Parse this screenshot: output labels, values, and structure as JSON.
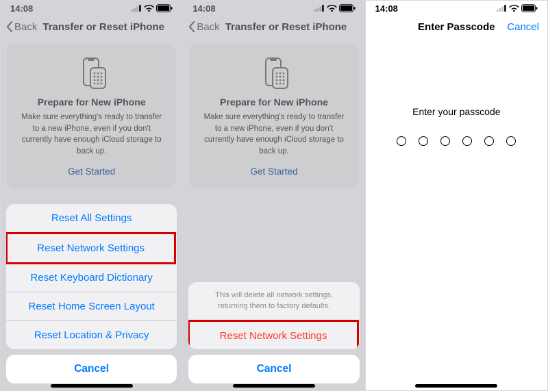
{
  "status": {
    "time": "14:08"
  },
  "nav": {
    "back_label": "Back",
    "title": "Transfer or Reset iPhone"
  },
  "card": {
    "heading": "Prepare for New iPhone",
    "body": "Make sure everything's ready to transfer to a new iPhone, even if you don't currently have enough iCloud storage to back up.",
    "cta": "Get Started"
  },
  "sheet1": {
    "items": {
      "reset_all": "Reset All Settings",
      "reset_network": "Reset Network Settings",
      "reset_keyboard": "Reset Keyboard Dictionary",
      "reset_home": "Reset Home Screen Layout",
      "reset_location": "Reset Location & Privacy"
    },
    "cancel": "Cancel"
  },
  "sheet2": {
    "message": "This will delete all network settings, returning them to factory defaults.",
    "confirm": "Reset Network Settings",
    "cancel": "Cancel"
  },
  "passcode": {
    "title": "Enter Passcode",
    "cancel": "Cancel",
    "prompt": "Enter your passcode"
  }
}
